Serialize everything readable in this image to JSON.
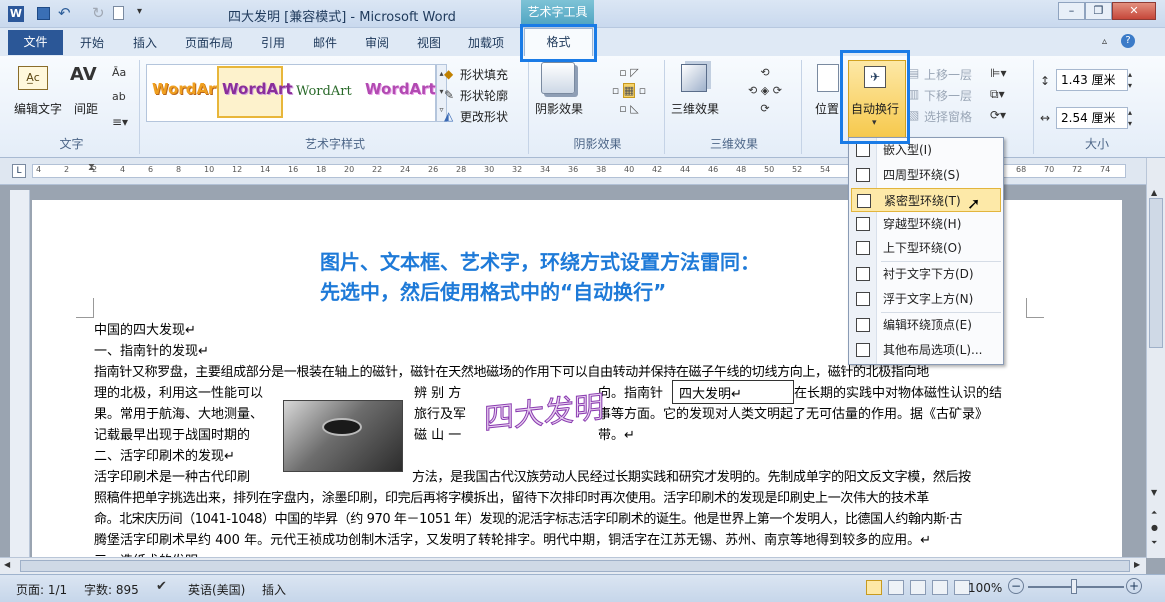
{
  "window": {
    "title": "四大发明 [兼容模式] - Microsoft Word",
    "contextual_tab_group": "艺术字工具"
  },
  "quick_access": {
    "app_icon": "W",
    "icons": [
      "save-icon",
      "undo-icon",
      "redo-icon",
      "new-doc-icon",
      "customize-icon"
    ]
  },
  "window_controls": {
    "minimize": "–",
    "restore": "❐",
    "close": "✕"
  },
  "tabs": [
    {
      "label": "文件"
    },
    {
      "label": "开始"
    },
    {
      "label": "插入"
    },
    {
      "label": "页面布局"
    },
    {
      "label": "引用"
    },
    {
      "label": "邮件"
    },
    {
      "label": "审阅"
    },
    {
      "label": "视图"
    },
    {
      "label": "加载项"
    },
    {
      "label": "格式"
    }
  ],
  "ribbon": {
    "text_group": {
      "label": "文字",
      "edit_text": "编辑文字",
      "spacing": "间距"
    },
    "wordart_styles": {
      "label": "艺术字样式",
      "samples": [
        "WordArt",
        "WordArt",
        "WordArt",
        "WordArt"
      ],
      "shape_fill": "形状填充",
      "shape_outline": "形状轮廓",
      "change_shape": "更改形状"
    },
    "shadow": {
      "label": "阴影效果",
      "button": "阴影效果"
    },
    "threed": {
      "label": "三维效果",
      "button": "三维效果"
    },
    "arrange": {
      "position": "位置",
      "wrap": "自动换行",
      "bring_forward": "上移一层",
      "send_backward": "下移一层",
      "selection_pane": "选择窗格"
    },
    "size": {
      "label": "大小",
      "height": "1.43 厘米",
      "width": "2.54 厘米"
    }
  },
  "wrap_menu": {
    "items": [
      "嵌入型(I)",
      "四周型环绕(S)",
      "紧密型环绕(T)",
      "穿越型环绕(H)",
      "上下型环绕(O)",
      "衬于文字下方(D)",
      "浮于文字上方(N)",
      "编辑环绕顶点(E)",
      "其他布局选项(L)..."
    ],
    "selected": "紧密型环绕(T)"
  },
  "ruler": {
    "ticks": [
      "4",
      "2",
      "2",
      "4",
      "6",
      "8",
      "10",
      "12",
      "14",
      "16",
      "18",
      "20",
      "22",
      "24",
      "26",
      "28",
      "30",
      "32",
      "34",
      "36",
      "38",
      "40",
      "42",
      "44",
      "46",
      "48",
      "50",
      "52",
      "54",
      "56",
      "58",
      "60",
      "62",
      "64",
      "66",
      "68",
      "70",
      "72",
      "74"
    ]
  },
  "document": {
    "annotation": [
      "图片、文本框、艺术字，环绕方式设置方法雷同：",
      "先选中，然后使用格式中的“自动换行”"
    ],
    "lines": [
      "中国的四大发现↵",
      "一、指南针的发现↵",
      "指南针又称罗盘，主要组成部分是一根装在轴上的磁针，磁针在天然地磁场的作用下可以自由转动并保持在磁子午线的切线方向上，磁针的北极指向地",
      "理的北极，利用这一性能可以",
      "果。常用于航海、大地测量、",
      "记载最早出现于战国时期的",
      "二、活字印刷术的发现↵",
      "活字印刷术是一种古代印刷",
      "照稿件把单字挑选出来，排列在字盘内，涂墨印刷，印完后再将字模拆出，留待下次排印时再次使用。活字印刷术的发现是印刷史上一次伟大的技术革",
      "命。北宋庆历间（1041-1048）中国的毕昇（约 970 年－1051 年）发现的泥活字标志活字印刷术的诞生。他是世界上第一个发明人，比德国人约翰内斯·古",
      "腾堡活字印刷术早约 400 年。元代王祯成功创制木活字，又发明了转轮排字。明代中期，铜活字在江苏无锡、苏州、南京等地得到较多的应用。↵",
      "三、造纸术的发明"
    ],
    "mid_col": [
      "辨 别 方",
      "旅行及军",
      "磁 山 一"
    ],
    "right_col": [
      "向。指南针",
      "事等方面。它的发现对人类文明起了无可估量的作用。据《古矿录》",
      "带。↵"
    ],
    "right_col2": "在长期的实践中对物体磁性认识的结",
    "right_after_print": "方法，是我国古代汉族劳动人民经过长期实践和研究才发明的。先制成单字的阳文反文字模，然后按",
    "wordart": "四大发明",
    "textbox": "四大发明↵"
  },
  "status": {
    "page": "页面: 1/1",
    "words": "字数: 895",
    "language": "英语(美国)",
    "mode": "插入",
    "zoom": "100%"
  }
}
